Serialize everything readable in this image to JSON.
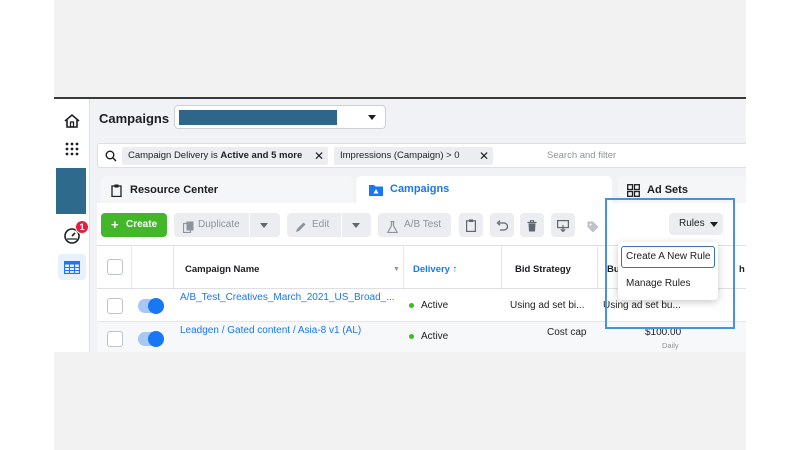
{
  "header": {
    "title": "Campaigns"
  },
  "rail": {
    "notification_count": "1"
  },
  "filters": {
    "chips": [
      {
        "prefix": "Campaign Delivery is ",
        "bold": "Active and 5 more"
      },
      {
        "prefix": "Impressions (Campaign) > 0",
        "bold": ""
      }
    ],
    "placeholder": "Search and filter"
  },
  "tabs": [
    {
      "label": "Resource Center"
    },
    {
      "label": "Campaigns"
    },
    {
      "label": "Ad Sets"
    }
  ],
  "toolbar": {
    "create": "Create",
    "duplicate": "Duplicate",
    "edit": "Edit",
    "ab_test": "A/B Test",
    "rules": "Rules"
  },
  "table": {
    "columns": [
      "Campaign Name",
      "Delivery ↑",
      "Bid Strategy",
      "Bud",
      "h"
    ],
    "rows": [
      {
        "name": "A/B_Test_Creatives_March_2021_US_Broad_...",
        "delivery": "Active",
        "bid": "Using ad set bi...",
        "budget": "Using ad set bu...",
        "budget_sub": ""
      },
      {
        "name": "Leadgen / Gated content / Asia-8 v1 (AL)",
        "delivery": "Active",
        "bid": "Cost cap",
        "budget": "$100.00",
        "budget_sub": "Daily"
      }
    ]
  },
  "rules_menu": {
    "items": [
      "Create A New Rule",
      "Manage Rules"
    ]
  },
  "colors": {
    "accent": "#1877f2",
    "create": "#42b72a",
    "highlight": "#4a8fe0"
  }
}
